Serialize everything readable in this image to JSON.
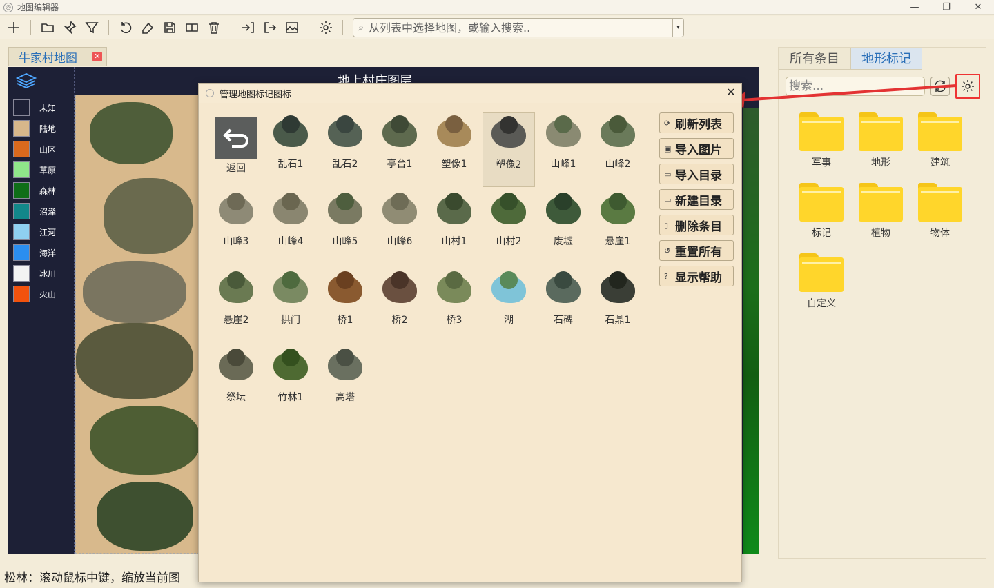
{
  "window": {
    "title": "地图编辑器",
    "min": "—",
    "max": "❐",
    "close": "✕"
  },
  "toolbar": {
    "search_placeholder": "从列表中选择地图，或输入搜索..",
    "dropdown": "▾"
  },
  "map_tab": {
    "label": "牛家村地图",
    "close": "✕"
  },
  "map": {
    "layer_title": "地上村庄图层",
    "legend": [
      {
        "label": "未知",
        "color": "#1d2036"
      },
      {
        "label": "陆地",
        "color": "#d7b78b"
      },
      {
        "label": "山区",
        "color": "#d9691d"
      },
      {
        "label": "草原",
        "color": "#8fe68a"
      },
      {
        "label": "森林",
        "color": "#0f6e18"
      },
      {
        "label": "沼泽",
        "color": "#12878a"
      },
      {
        "label": "江河",
        "color": "#8fd0f0"
      },
      {
        "label": "海洋",
        "color": "#2b8ef0"
      },
      {
        "label": "冰川",
        "color": "#f3f3f3"
      },
      {
        "label": "火山",
        "color": "#f2520d"
      }
    ]
  },
  "status": {
    "text": "松林：滚动鼠标中键，缩放当前图"
  },
  "right_panel": {
    "tabs": [
      {
        "label": "所有条目"
      },
      {
        "label": "地形标记"
      }
    ],
    "search_placeholder": "搜索...",
    "folders": [
      {
        "label": "军事"
      },
      {
        "label": "地形"
      },
      {
        "label": "建筑"
      },
      {
        "label": "标记"
      },
      {
        "label": "植物"
      },
      {
        "label": "物体"
      },
      {
        "label": "自定义"
      }
    ]
  },
  "dialog": {
    "title": "管理地图标记图标",
    "close": "✕",
    "back_label": "返回",
    "items": [
      {
        "label": "乱石1",
        "c1": "#4a5a4a",
        "c2": "#2f3a34"
      },
      {
        "label": "乱石2",
        "c1": "#556255",
        "c2": "#3a4640"
      },
      {
        "label": "亭台1",
        "c1": "#5e6a4e",
        "c2": "#3f4a36"
      },
      {
        "label": "塑像1",
        "c1": "#a88a5a",
        "c2": "#7a6040"
      },
      {
        "label": "塑像2",
        "c1": "#5a5a56",
        "c2": "#333331"
      },
      {
        "label": "山峰1",
        "c1": "#8a8a72",
        "c2": "#5a6a4a"
      },
      {
        "label": "山峰2",
        "c1": "#6a7a5a",
        "c2": "#4a5a3a"
      },
      {
        "label": "山峰3",
        "c1": "#8e8a76",
        "c2": "#6e6a56"
      },
      {
        "label": "山峰4",
        "c1": "#8a8670",
        "c2": "#6a6650"
      },
      {
        "label": "山峰5",
        "c1": "#7a7a62",
        "c2": "#4e5e3e"
      },
      {
        "label": "山峰6",
        "c1": "#908c74",
        "c2": "#6e6c56"
      },
      {
        "label": "山村1",
        "c1": "#5a6a4a",
        "c2": "#3a4a2e"
      },
      {
        "label": "山村2",
        "c1": "#4e6a3a",
        "c2": "#36502a"
      },
      {
        "label": "废墟",
        "c1": "#3e5a3a",
        "c2": "#2a402a"
      },
      {
        "label": "悬崖1",
        "c1": "#5a7a42",
        "c2": "#3e5a30"
      },
      {
        "label": "悬崖2",
        "c1": "#6a7a52",
        "c2": "#4a5a3a"
      },
      {
        "label": "拱门",
        "c1": "#7a8a62",
        "c2": "#4e6a3e"
      },
      {
        "label": "桥1",
        "c1": "#8a5a30",
        "c2": "#6a4020"
      },
      {
        "label": "桥2",
        "c1": "#6a5040",
        "c2": "#4a3428"
      },
      {
        "label": "桥3",
        "c1": "#7a8a5a",
        "c2": "#5a6a42"
      },
      {
        "label": "湖",
        "c1": "#7fc4d8",
        "c2": "#5a8a5a"
      },
      {
        "label": "石碑",
        "c1": "#5a6a5e",
        "c2": "#3a4a40"
      },
      {
        "label": "石鼎1",
        "c1": "#3a3e36",
        "c2": "#22261e"
      },
      {
        "label": "祭坛",
        "c1": "#6a6a56",
        "c2": "#4a4a3a"
      },
      {
        "label": "竹林1",
        "c1": "#4e6a32",
        "c2": "#34501e"
      },
      {
        "label": "高塔",
        "c1": "#6a7060",
        "c2": "#4a5044"
      }
    ],
    "actions": [
      {
        "icon": "⟳",
        "label": "刷新列表"
      },
      {
        "icon": "▣",
        "label": "导入图片"
      },
      {
        "icon": "▭",
        "label": "导入目录"
      },
      {
        "icon": "▭",
        "label": "新建目录"
      },
      {
        "icon": "▯",
        "label": "删除条目"
      },
      {
        "icon": "↺",
        "label": "重置所有"
      },
      {
        "icon": "?",
        "label": "显示帮助"
      }
    ]
  },
  "colors": {
    "accent_blue": "#2a6fb8",
    "highlight_red": "#e33333",
    "dialog_bg": "#f6e8cf"
  }
}
